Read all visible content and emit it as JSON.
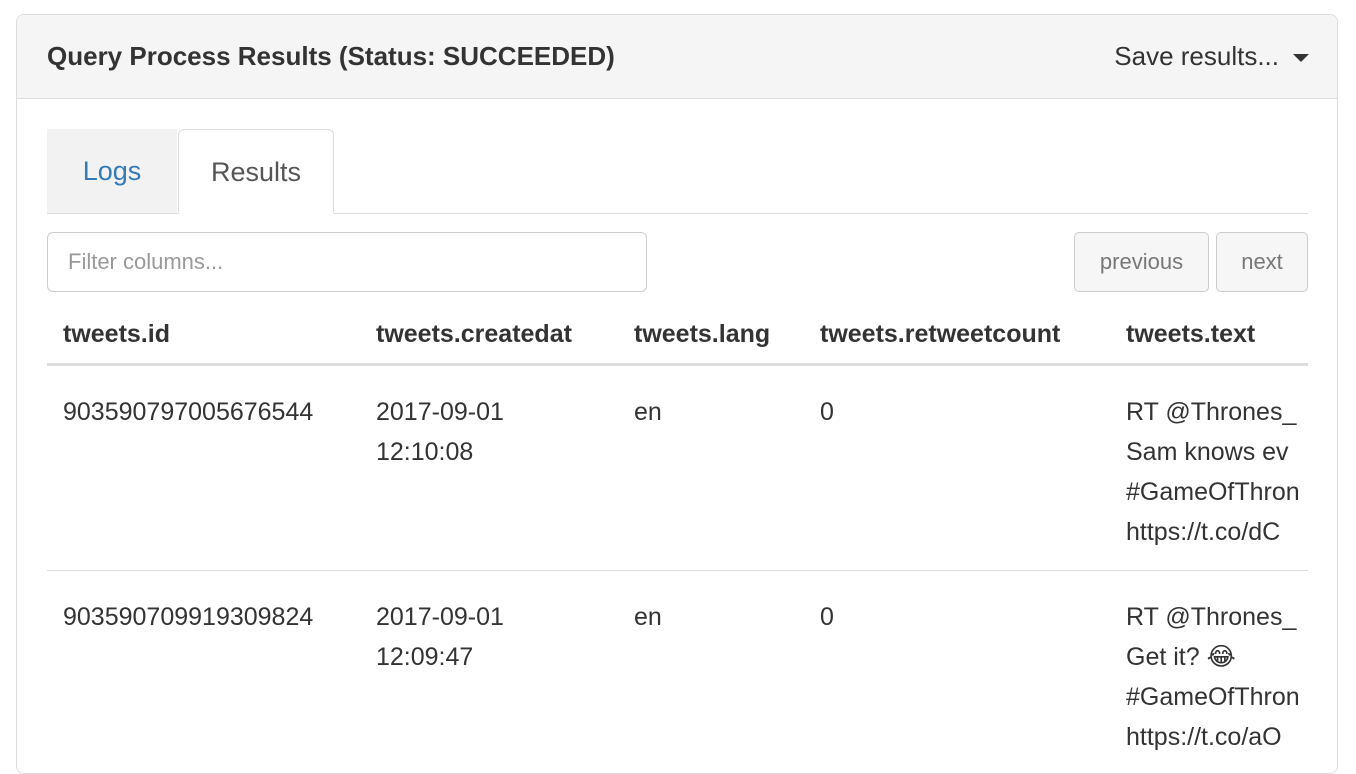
{
  "header": {
    "title": "Query Process Results (Status: SUCCEEDED)",
    "save_label": "Save results..."
  },
  "tabs": [
    {
      "label": "Logs",
      "active": false
    },
    {
      "label": "Results",
      "active": true
    }
  ],
  "filter": {
    "placeholder": "Filter columns...",
    "value": ""
  },
  "pager": {
    "previous_label": "previous",
    "next_label": "next"
  },
  "table": {
    "columns": [
      "tweets.id",
      "tweets.createdat",
      "tweets.lang",
      "tweets.retweetcount",
      "tweets.text"
    ],
    "rows": [
      {
        "id": "903590797005676544",
        "createdat": "2017-09-01\n12:10:08",
        "lang": "en",
        "retweetcount": "0",
        "text": "RT @Thrones_\nSam knows ev\n#GameOfThron\nhttps://t.co/dC"
      },
      {
        "id": "903590709919309824",
        "createdat": "2017-09-01\n12:09:47",
        "lang": "en",
        "retweetcount": "0",
        "text": "RT @Thrones_\nGet it? 😂\n#GameOfThron\nhttps://t.co/aO"
      }
    ]
  },
  "colors": {
    "link": "#337ab7",
    "heading_bg": "#f5f5f5",
    "border": "#dddddd"
  }
}
